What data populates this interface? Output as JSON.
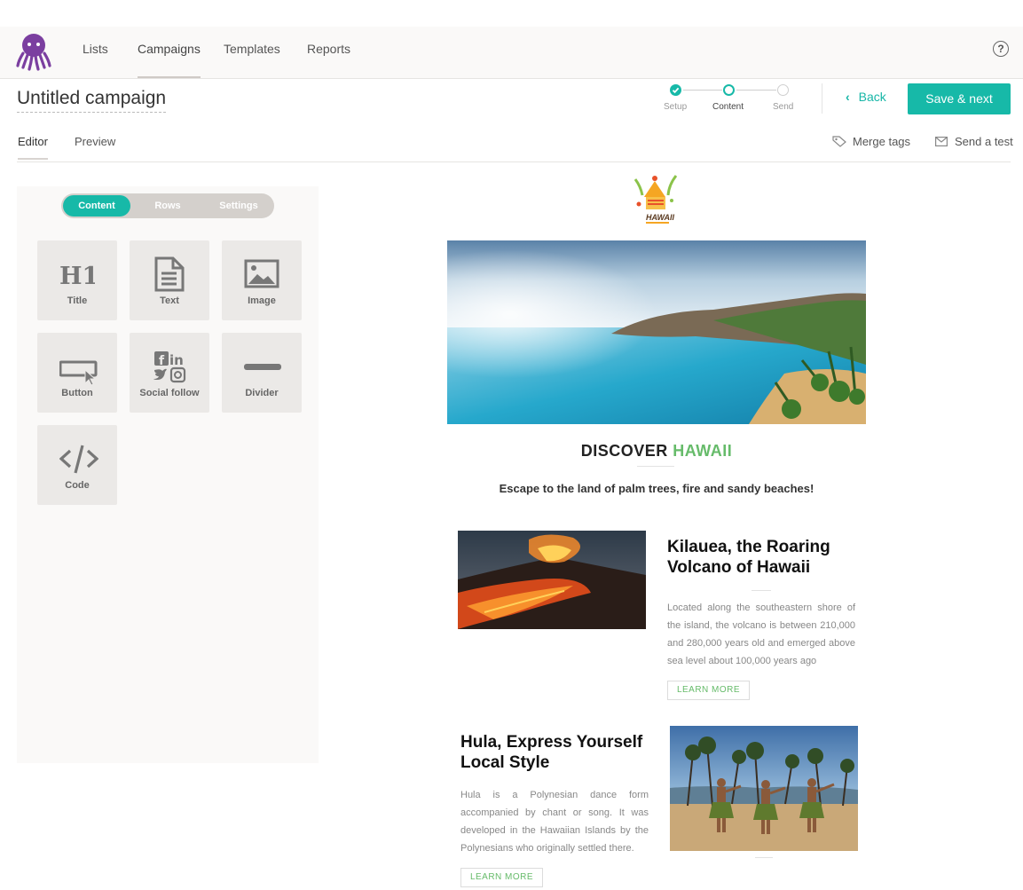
{
  "nav": {
    "items": [
      "Lists",
      "Campaigns",
      "Templates",
      "Reports"
    ],
    "active": "Campaigns",
    "help_glyph": "?"
  },
  "campaign": {
    "title": "Untitled campaign"
  },
  "steps": [
    {
      "label": "Setup",
      "state": "done"
    },
    {
      "label": "Content",
      "state": "current"
    },
    {
      "label": "Send",
      "state": "todo"
    }
  ],
  "actions": {
    "back_label": "Back",
    "save_label": "Save & next"
  },
  "editor_tabs": {
    "editor": "Editor",
    "preview": "Preview",
    "active": "Editor"
  },
  "tools": {
    "merge_tags": "Merge tags",
    "send_test": "Send a test"
  },
  "panel": {
    "segments": [
      "Content",
      "Rows",
      "Settings"
    ],
    "active_segment": "Content",
    "blocks": [
      {
        "label": "Title",
        "icon": "h1-icon"
      },
      {
        "label": "Text",
        "icon": "document-icon"
      },
      {
        "label": "Image",
        "icon": "image-icon"
      },
      {
        "label": "Button",
        "icon": "button-cursor-icon"
      },
      {
        "label": "Social follow",
        "icon": "social-icon"
      },
      {
        "label": "Divider",
        "icon": "divider-icon"
      },
      {
        "label": "Code",
        "icon": "code-icon"
      }
    ]
  },
  "email": {
    "logo_text": "HAWAII",
    "heading_prefix": "DISCOVER",
    "heading_highlight": "HAWAII",
    "subheading": "Escape to the land of palm trees, fire and sandy beaches!",
    "articles": [
      {
        "title": "Kilauea, the Roaring Volcano of Hawaii",
        "body": "Located along the southeastern shore of the island, the volcano is between 210,000 and 280,000 years old and emerged above sea level about 100,000 years ago",
        "cta": "LEARN MORE"
      },
      {
        "title": "Hula, Express Yourself Local Style",
        "body": "Hula is a Polynesian dance form accompanied by chant or song. It was developed in the Hawaiian Islands by the Polynesians who originally settled there.",
        "cta": "LEARN MORE"
      }
    ]
  },
  "colors": {
    "accent": "#17b9a8",
    "highlight": "#66bb6a",
    "brand": "#7b3fa0"
  }
}
